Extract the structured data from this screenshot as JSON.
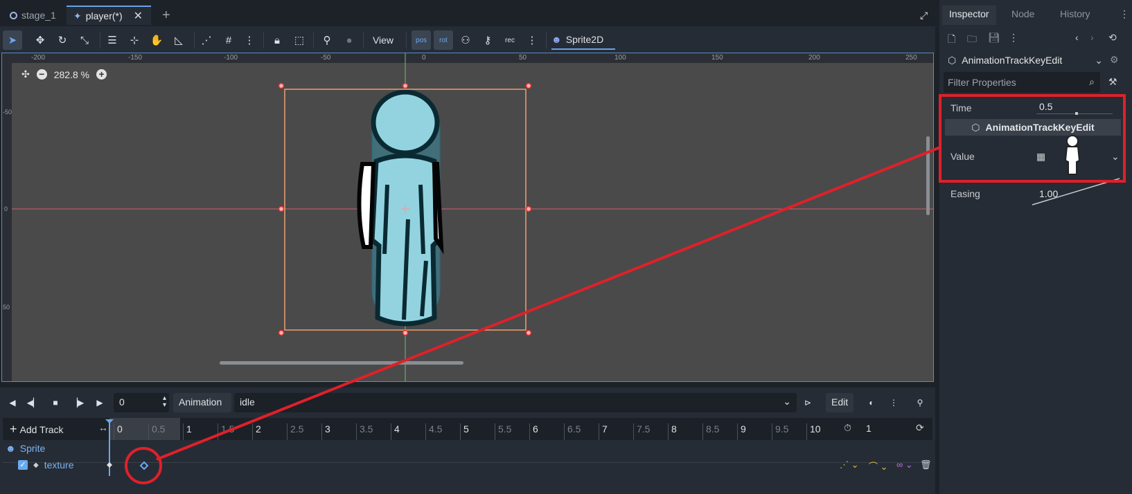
{
  "tabs": [
    {
      "label": "stage_1",
      "icon": "circle-icon"
    },
    {
      "label": "player(*)",
      "icon": "node-icon"
    }
  ],
  "toolbar": {
    "view_label": "View",
    "pos_label": "pos",
    "rot_label": "rot",
    "rec_label": "rec",
    "node_type": "Sprite2D"
  },
  "viewport": {
    "zoom": "282.8 %",
    "ruler_h": [
      "-200",
      "-150",
      "-100",
      "-50",
      "0",
      "50",
      "100",
      "150",
      "200",
      "250"
    ],
    "ruler_v": [
      "-50",
      "0",
      "50"
    ]
  },
  "animation": {
    "frame_value": "0",
    "animation_label": "Animation",
    "animation_name": "idle",
    "edit_label": "Edit",
    "add_track_label": "Add Track",
    "timeline_ticks": [
      "0",
      "0.5",
      "1",
      "1.5",
      "2",
      "2.5",
      "3",
      "3.5",
      "4",
      "4.5",
      "5",
      "5.5",
      "6",
      "6.5",
      "7",
      "7.5",
      "8",
      "8.5",
      "9",
      "9.5",
      "10"
    ],
    "length_value": "1",
    "track_node": "Sprite",
    "track_property": "texture"
  },
  "inspector": {
    "tabs": [
      "Inspector",
      "Node",
      "History"
    ],
    "object_name": "AnimationTrackKeyEdit",
    "filter_placeholder": "Filter Properties",
    "time_label": "Time",
    "time_value": "0.5",
    "section_title": "AnimationTrackKeyEdit",
    "value_label": "Value",
    "easing_label": "Easing",
    "easing_value": "1.00"
  },
  "colors": {
    "accent": "#6aa9ef",
    "annotation_red": "#e0202a",
    "selection_orange": "#f0a070"
  }
}
